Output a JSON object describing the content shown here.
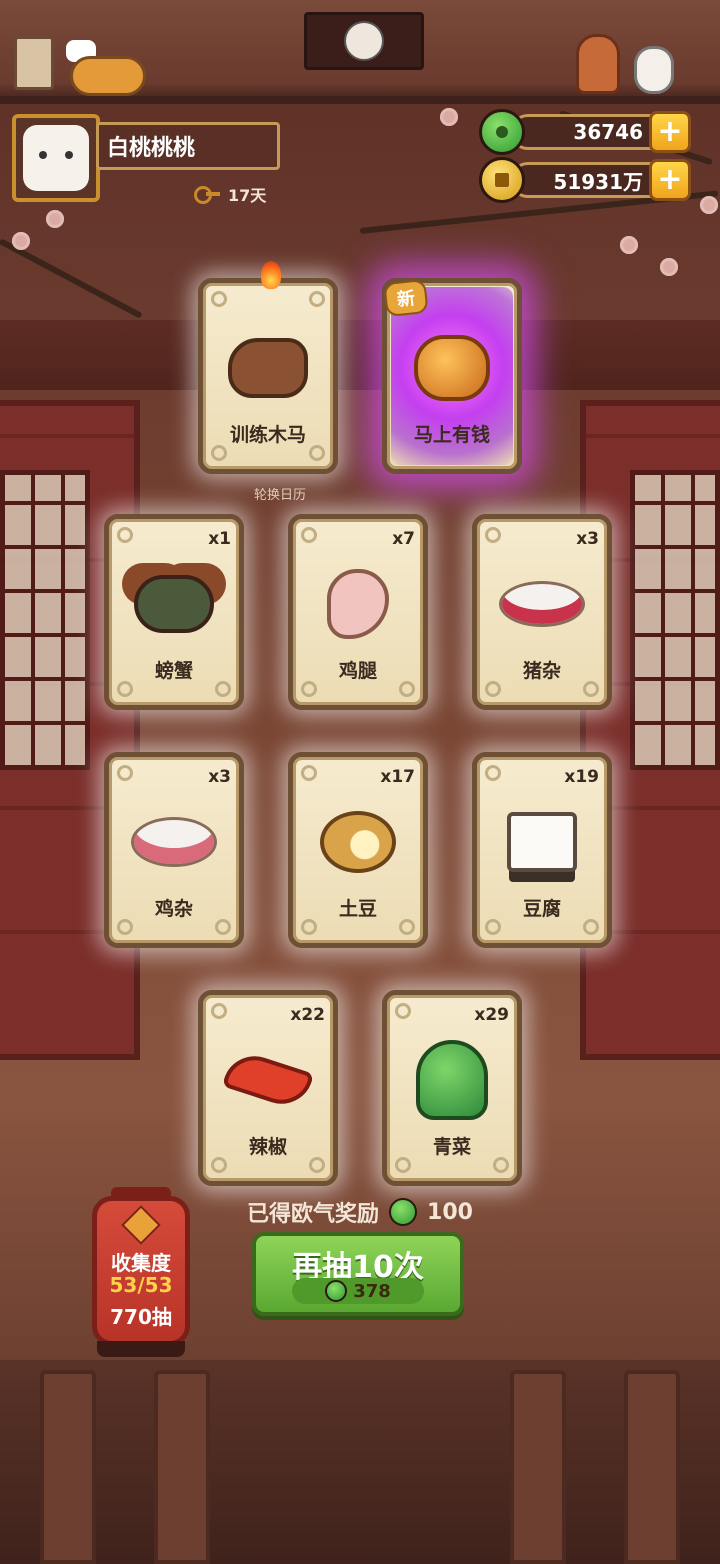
{
  "player": {
    "name": "白桃桃桃",
    "days": "17天"
  },
  "currencies": {
    "jade": "36746",
    "coins": "51931万"
  },
  "featured_cards": [
    {
      "label": "训练木马",
      "badge": "",
      "count": ""
    },
    {
      "label": "马上有钱",
      "badge": "新",
      "count": ""
    }
  ],
  "rotate_caption": "轮换日历",
  "cards": [
    {
      "label": "螃蟹",
      "count": "x1"
    },
    {
      "label": "鸡腿",
      "count": "x7"
    },
    {
      "label": "猪杂",
      "count": "x3"
    },
    {
      "label": "鸡杂",
      "count": "x3"
    },
    {
      "label": "土豆",
      "count": "x17"
    },
    {
      "label": "豆腐",
      "count": "x19"
    },
    {
      "label": "辣椒",
      "count": "x22"
    },
    {
      "label": "青菜",
      "count": "x29"
    }
  ],
  "reward": {
    "text": "已得欧气奖励",
    "value": "100"
  },
  "draw_button": {
    "title": "再抽10次",
    "cost": "378"
  },
  "collection": {
    "title": "收集度",
    "progress": "53/53",
    "draws": "770抽"
  }
}
